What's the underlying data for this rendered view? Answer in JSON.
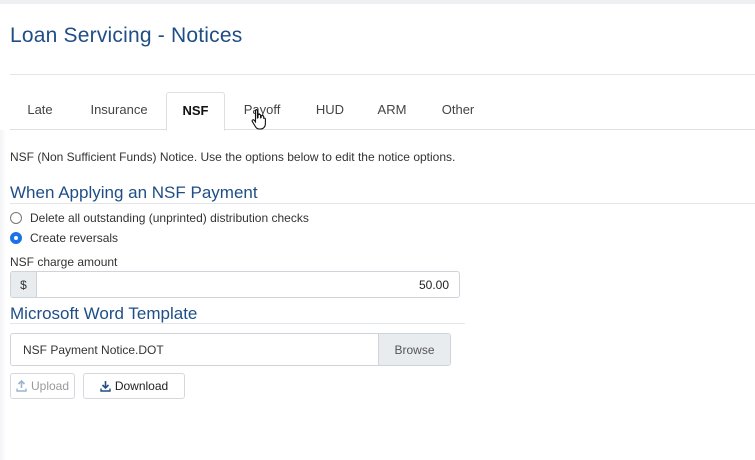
{
  "page": {
    "title": "Loan Servicing - Notices"
  },
  "tabs": [
    {
      "label": "Late",
      "active": false
    },
    {
      "label": "Insurance",
      "active": false
    },
    {
      "label": "NSF",
      "active": true
    },
    {
      "label": "Payoff",
      "active": false
    },
    {
      "label": "HUD",
      "active": false
    },
    {
      "label": "ARM",
      "active": false
    },
    {
      "label": "Other",
      "active": false
    }
  ],
  "description": "NSF (Non Sufficient Funds) Notice. Use the options below to edit the notice options.",
  "nsf_section": {
    "heading": "When Applying an NSF Payment",
    "options": [
      {
        "label": "Delete all outstanding (unprinted) distribution checks",
        "checked": false
      },
      {
        "label": "Create reversals",
        "checked": true
      }
    ],
    "charge_label": "NSF charge amount",
    "currency_symbol": "$",
    "charge_value": "50.00"
  },
  "template_section": {
    "heading": "Microsoft Word Template",
    "file_name": "NSF Payment Notice.DOT",
    "browse_label": "Browse",
    "upload_label": "Upload",
    "download_label": "Download"
  },
  "icons": {
    "upload": "upload-icon",
    "download": "download-icon",
    "cursor": "hand-pointer-icon"
  },
  "colors": {
    "heading": "#1f4e86",
    "radio_checked": "#1a73e8"
  }
}
